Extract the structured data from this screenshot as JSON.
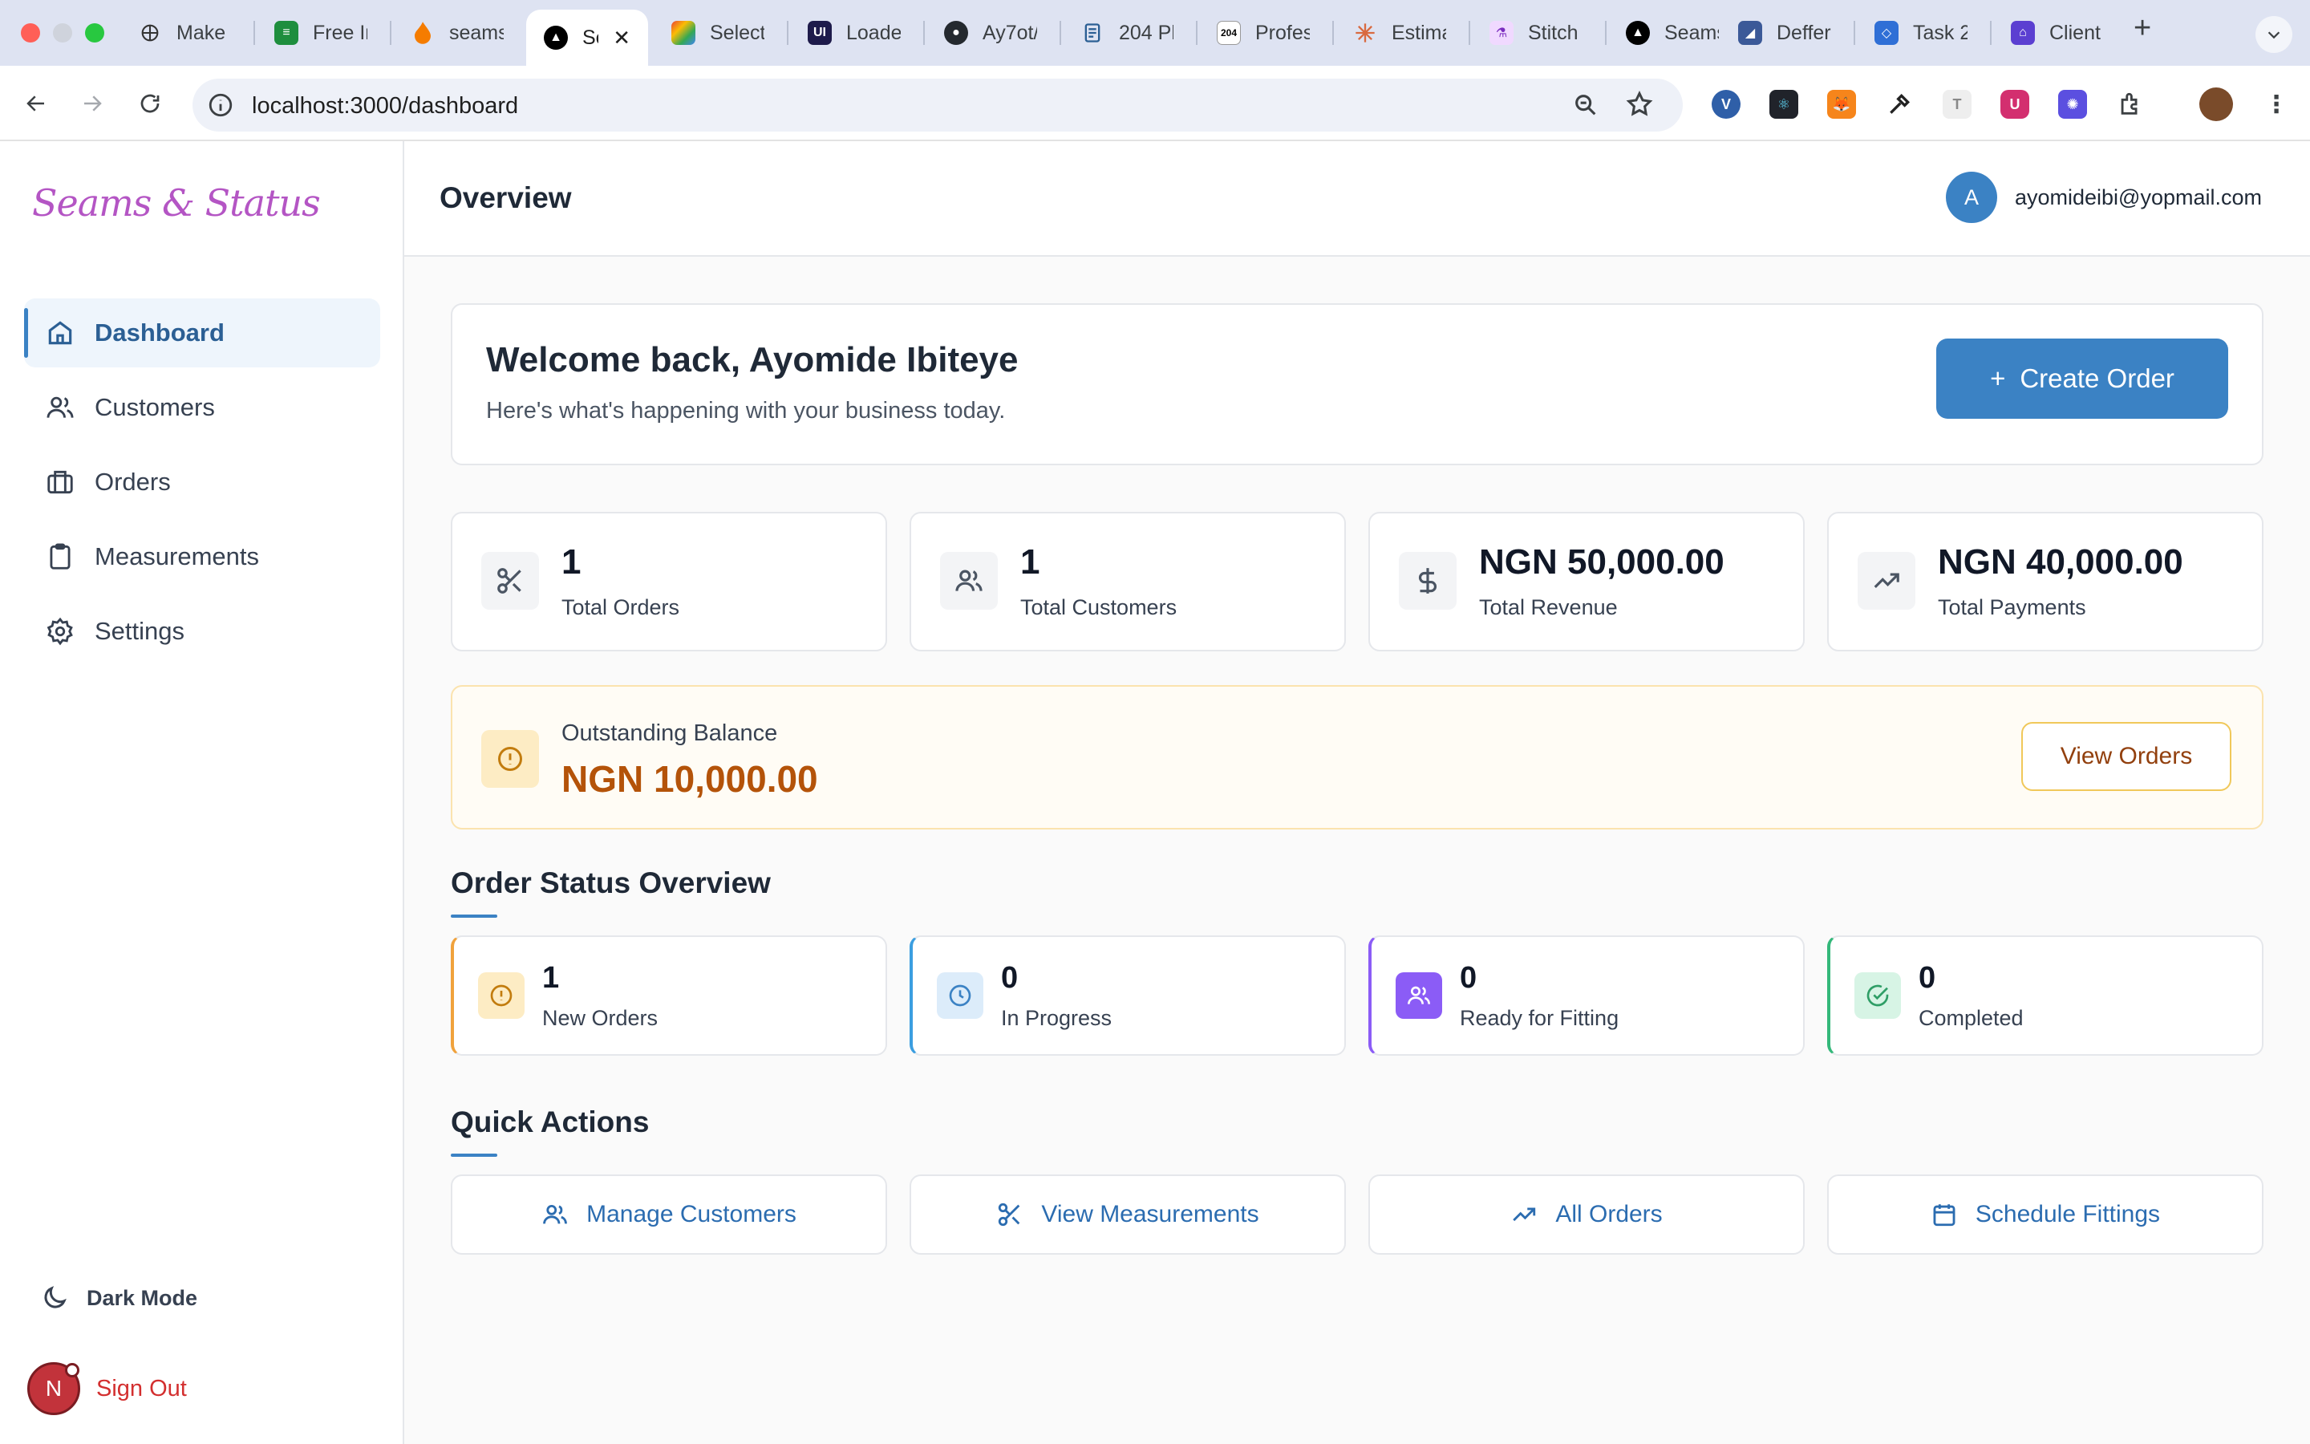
{
  "browser": {
    "tabs": [
      {
        "title": "Make a"
      },
      {
        "title": "Free Ir"
      },
      {
        "title": "seams"
      },
      {
        "title": "Se"
      },
      {
        "title": "Select"
      },
      {
        "title": "Loade"
      },
      {
        "title": "Ay7ot/"
      },
      {
        "title": "204 Pl"
      },
      {
        "title": "Profes"
      },
      {
        "title": "Estima"
      },
      {
        "title": "Stitch"
      },
      {
        "title": "Seams"
      },
      {
        "title": "Deffer"
      },
      {
        "title": "Task 2"
      },
      {
        "title": "Client"
      }
    ],
    "new_tab": "+",
    "close_glyph": "✕",
    "url": "localhost:3000/dashboard",
    "favicon_204": "204"
  },
  "app": {
    "logo": "Seams & Status",
    "nav": [
      {
        "label": "Dashboard",
        "icon": "home-icon"
      },
      {
        "label": "Customers",
        "icon": "users-icon"
      },
      {
        "label": "Orders",
        "icon": "briefcase-icon"
      },
      {
        "label": "Measurements",
        "icon": "clipboard-icon"
      },
      {
        "label": "Settings",
        "icon": "gear-icon"
      }
    ],
    "dark_mode": "Dark Mode",
    "sign_out": "Sign Out",
    "sign_out_avatar": "N"
  },
  "header": {
    "title": "Overview",
    "avatar_letter": "A",
    "email": "ayomideibi@yopmail.com"
  },
  "welcome": {
    "heading": "Welcome back, Ayomide Ibiteye",
    "subtext": "Here's what's happening with your business today.",
    "create_button": "Create Order",
    "create_plus": "+"
  },
  "stats": [
    {
      "value": "1",
      "label": "Total Orders",
      "icon": "scissors-icon"
    },
    {
      "value": "1",
      "label": "Total Customers",
      "icon": "users-icon"
    },
    {
      "value": "NGN 50,000.00",
      "label": "Total Revenue",
      "icon": "dollar-icon"
    },
    {
      "value": "NGN 40,000.00",
      "label": "Total Payments",
      "icon": "trending-up-icon"
    }
  ],
  "outstanding": {
    "label": "Outstanding Balance",
    "value": "NGN 10,000.00",
    "button": "View Orders"
  },
  "order_status": {
    "title": "Order Status Overview",
    "items": [
      {
        "value": "1",
        "label": "New Orders",
        "accent": "#f0a23c"
      },
      {
        "value": "0",
        "label": "In Progress",
        "accent": "#3b9ee0"
      },
      {
        "value": "0",
        "label": "Ready for Fitting",
        "accent": "#8b5cf6"
      },
      {
        "value": "0",
        "label": "Completed",
        "accent": "#34b87a"
      }
    ]
  },
  "quick_actions": {
    "title": "Quick Actions",
    "items": [
      {
        "label": "Manage Customers",
        "icon": "users-icon"
      },
      {
        "label": "View Measurements",
        "icon": "scissors-icon"
      },
      {
        "label": "All Orders",
        "icon": "trending-up-icon"
      },
      {
        "label": "Schedule Fittings",
        "icon": "calendar-icon"
      }
    ]
  },
  "colors": {
    "primary": "#3b82c4",
    "sidebar_active_bg": "#eef5fc",
    "outstanding_value": "#b45309",
    "sign_out": "#d32f2f",
    "logo": "#b455c4"
  }
}
